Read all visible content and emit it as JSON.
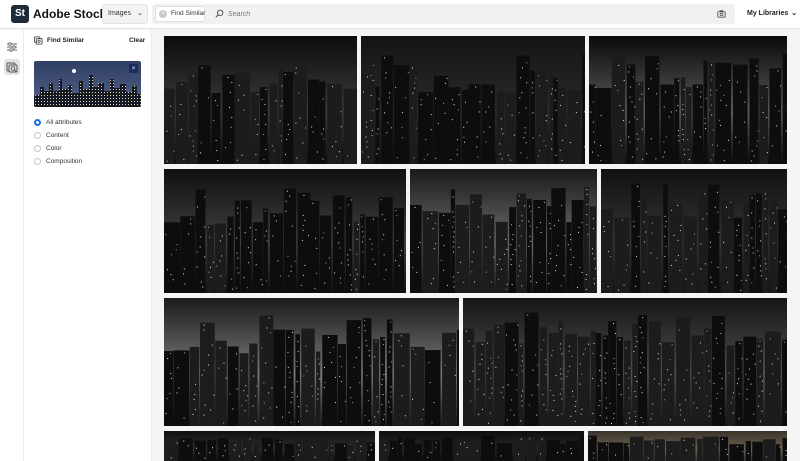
{
  "app": {
    "logo_mark": "St",
    "title": "Adobe Stock"
  },
  "header": {
    "asset_type": "Images",
    "chip_label": "Find Similar",
    "search_placeholder": "Search",
    "libraries_label": "My Libraries",
    "icons": [
      "chevron-down-icon",
      "close-icon",
      "search-icon",
      "camera-icon"
    ]
  },
  "rail": {
    "items": [
      "filters-icon",
      "find-similar-icon"
    ]
  },
  "panel": {
    "title": "Find Similar",
    "clear_label": "Clear",
    "options": [
      {
        "label": "All attributes",
        "selected": true
      },
      {
        "label": "Content",
        "selected": false
      },
      {
        "label": "Color",
        "selected": false
      },
      {
        "label": "Composition",
        "selected": false
      }
    ]
  },
  "results": {
    "count_visible": 11,
    "style": "black-and-white night city skyline",
    "accent": "#1473e6"
  }
}
